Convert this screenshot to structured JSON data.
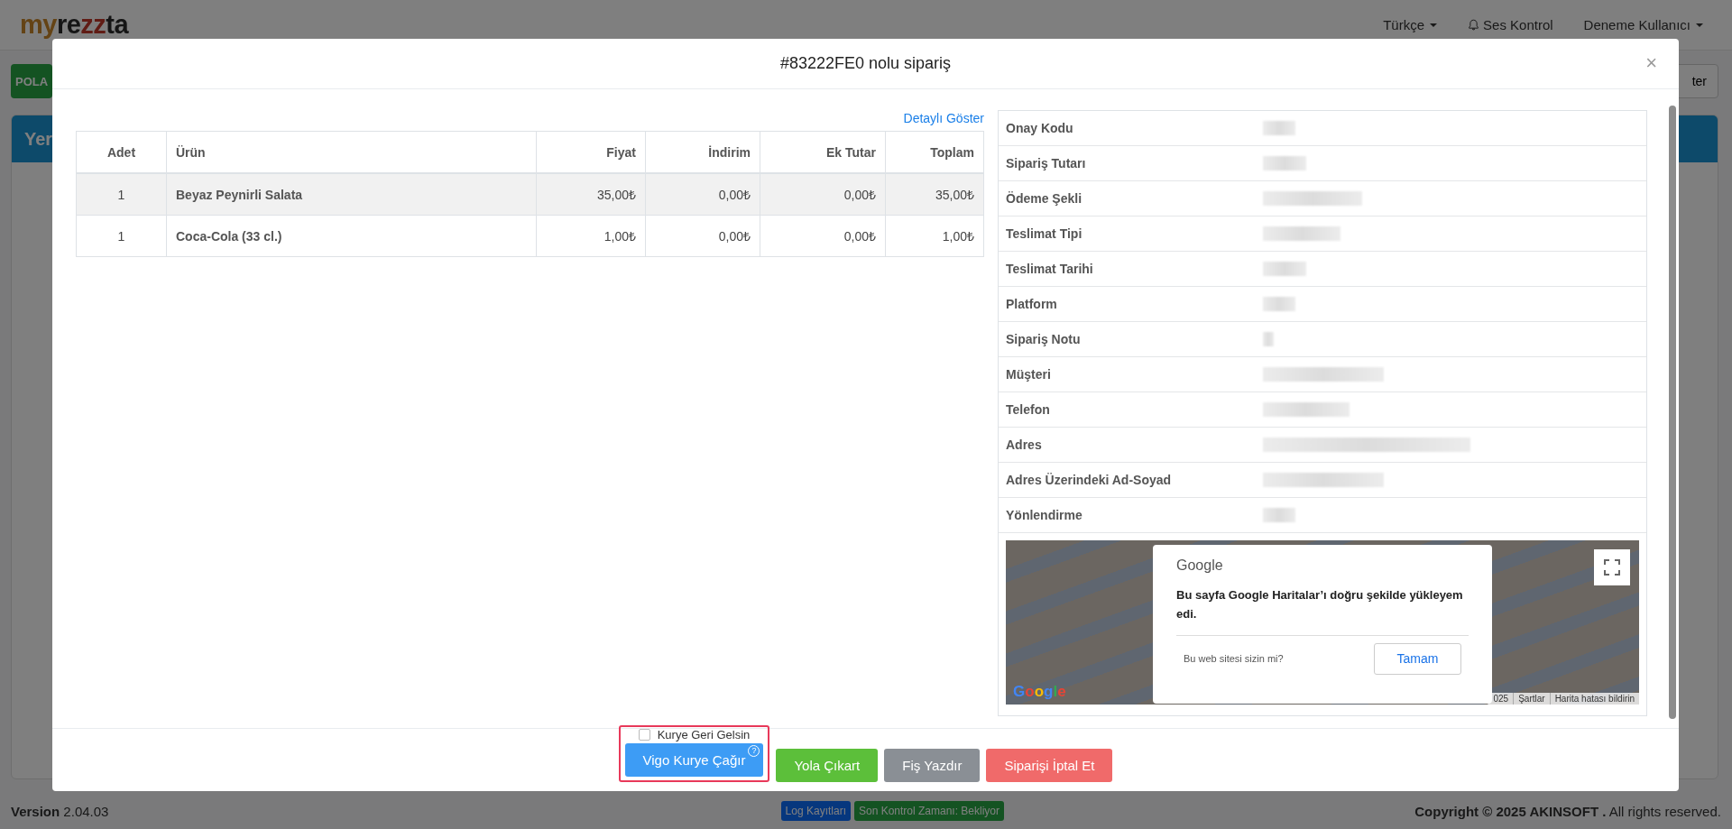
{
  "page": {
    "logo": [
      "my",
      "re",
      "zz",
      "ta"
    ],
    "nav": [
      {
        "label": "Türkçe",
        "kind": "dropdown"
      },
      {
        "label": "Ses Kontrol",
        "kind": "bell"
      },
      {
        "label": "Deneme Kullanıcı",
        "kind": "dropdown"
      }
    ],
    "left_button": "POLA",
    "card_header": "Yer",
    "right_button": "ter"
  },
  "modal": {
    "title": "#83222FE0 nolu sipariş",
    "close": "×",
    "details_link": "Detaylı Göster",
    "order_table": {
      "columns": [
        "Adet",
        "Ürün",
        "Fiyat",
        "İndirim",
        "Ek Tutar",
        "Toplam"
      ],
      "rows": [
        {
          "cells": [
            "1",
            "Beyaz Peynirli Salata",
            "35,00₺",
            "0,00₺",
            "0,00₺",
            "35,00₺"
          ],
          "highlighted": true
        },
        {
          "cells": [
            "1",
            "Coca-Cola (33 cl.)",
            "1,00₺",
            "0,00₺",
            "0,00₺",
            "1,00₺"
          ],
          "highlighted": false
        }
      ]
    },
    "info_rows": [
      "Onay Kodu",
      "Sipariş Tutarı",
      "Ödeme Şekli",
      "Teslimat Tipi",
      "Teslimat Tarihi",
      "Platform",
      "Sipariş Notu",
      "Müşteri",
      "Telefon",
      "Adres",
      "Adres Üzerindeki Ad-Soyad",
      "Yönlendirme"
    ],
    "map": {
      "dialog": {
        "brand": "Google",
        "message": "Bu sayfa Google Haritalar’ı doğru şekilde yükleyem edi.",
        "question": "Bu web sitesi sizin mi?",
        "button": "Tamam"
      },
      "logo": "Google",
      "attribution": [
        "025",
        "Şartlar",
        "Harita hatası bildirin"
      ]
    },
    "footer": {
      "courier_return": {
        "label": "Kurye Geri Gelsin",
        "checked": false
      },
      "highlighted": true,
      "buttons": [
        {
          "label": "Vigo Kurye Çağır",
          "kind": "primary",
          "help": "?"
        },
        {
          "label": "Yola Çıkart",
          "kind": "success"
        },
        {
          "label": "Fiş Yazdır",
          "kind": "secondary"
        },
        {
          "label": "Siparişi İptal Et",
          "kind": "danger"
        }
      ]
    }
  },
  "footer": {
    "version": "**Version** 2.04.03",
    "badges": [
      {
        "label": "Log Kayıtları",
        "kind": "info"
      },
      {
        "label": "Son Kontrol Zamanı: Bekliyor",
        "kind": "success"
      }
    ],
    "copyright": "**Copyright © 2025 AKINSOFT .** All rights reserved."
  }
}
